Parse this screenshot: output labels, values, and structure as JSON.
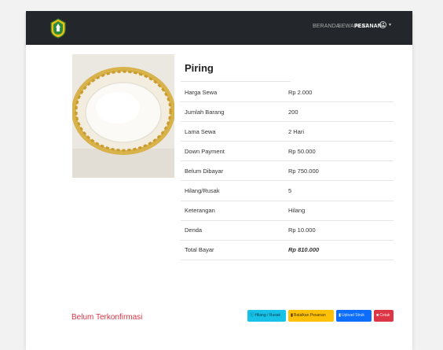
{
  "navbar": {
    "links": [
      {
        "label": "BERANDA",
        "active": false
      },
      {
        "label": "SEWA ALAT",
        "active": false
      },
      {
        "label": "PESANAN",
        "active": true
      }
    ],
    "user_icon": "user-circle-icon",
    "caret": "▾",
    "logo_icon": "regency-emblem-icon"
  },
  "product": {
    "title": "Piring",
    "image_icon": "plate-photo"
  },
  "details": [
    {
      "label": "Harga Sewa",
      "value": "Rp 2.000"
    },
    {
      "label": "Jumlah Barang",
      "value": "200"
    },
    {
      "label": "Lama Sewa",
      "value": "2 Hari"
    },
    {
      "label": "Down Payment",
      "value": "Rp 50.000"
    },
    {
      "label": "Belum Dibayar",
      "value": "Rp 750.000"
    },
    {
      "label": "Hilang/Rusak",
      "value": "5"
    },
    {
      "label": "Keterangan",
      "value": "Hilang"
    },
    {
      "label": "Denda",
      "value": "Rp 10.000"
    },
    {
      "label": "Total Bayar",
      "value": "Rp 810.000"
    }
  ],
  "status": "Belum Terkonfirmasi",
  "actions": {
    "lost_damaged": "Hilang / Rusak",
    "cancel_order": "Batalkan Pesanan",
    "upload_receipt": "Upload Struk",
    "print": "Cetak"
  },
  "colors": {
    "navbar": "#23272b",
    "status": "#dc3545",
    "info": "#17c1e8",
    "warning": "#ffc107",
    "primary": "#0d6efd",
    "danger": "#dc3545"
  }
}
